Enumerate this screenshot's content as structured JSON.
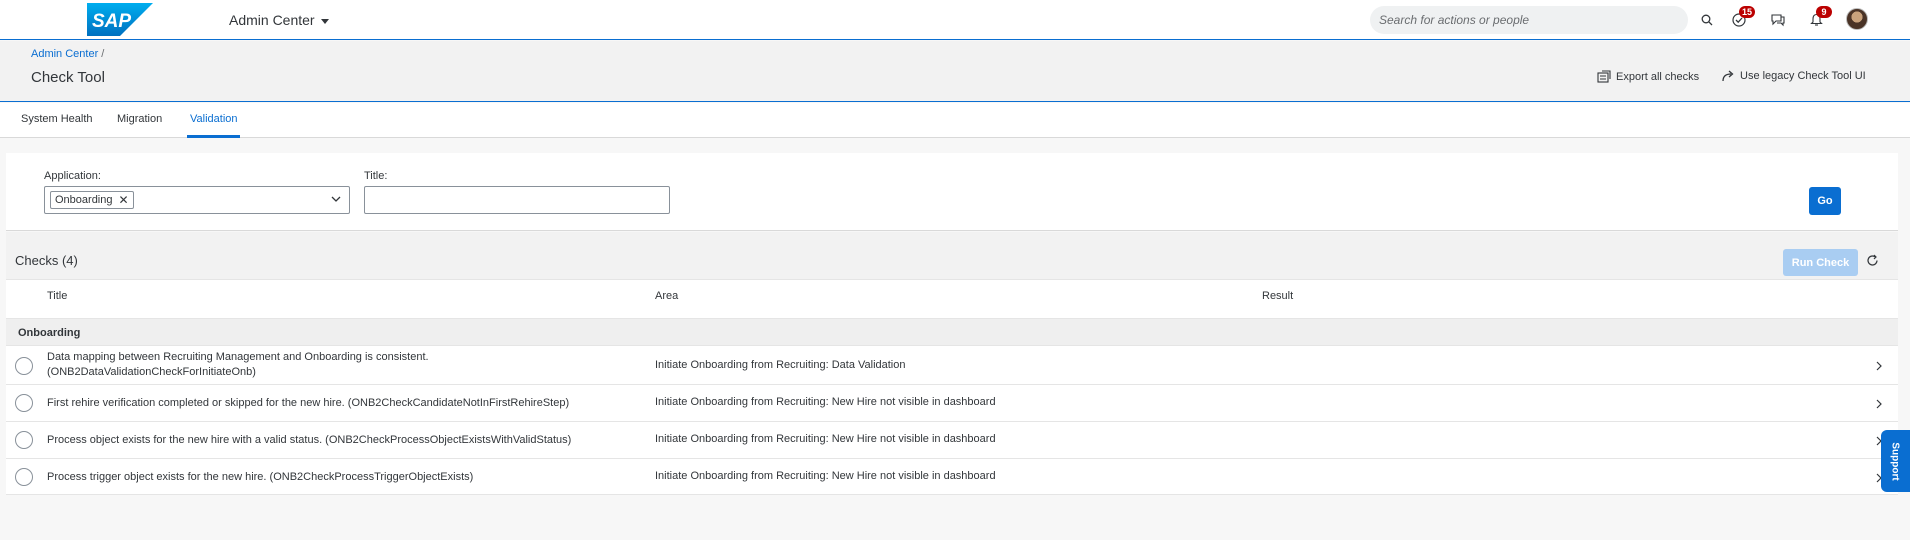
{
  "shell": {
    "logo_text": "SAP",
    "app_title": "Admin Center",
    "search_placeholder": "Search for actions or people",
    "todo_badge": "15",
    "notifications_badge": "9",
    "brand_color": "#0a6ed1"
  },
  "page": {
    "breadcrumb": "Admin Center",
    "breadcrumb_sep": "/",
    "title": "Check Tool",
    "actions": {
      "export": "Export all checks",
      "legacy": "Use legacy Check Tool UI"
    }
  },
  "tabs": [
    {
      "label": "System Health",
      "active": false
    },
    {
      "label": "Migration",
      "active": false
    },
    {
      "label": "Validation",
      "active": true
    }
  ],
  "filter": {
    "application_label": "Application:",
    "application_token": "Onboarding",
    "title_label": "Title:",
    "title_value": "",
    "go_label": "Go"
  },
  "checks": {
    "title": "Checks (4)",
    "run_label": "Run Check",
    "columns": [
      "Title",
      "Area",
      "Result"
    ],
    "group": "Onboarding",
    "rows": [
      {
        "title_line1": "Data mapping between Recruiting Management and Onboarding is consistent.",
        "title_line2": "(ONB2DataValidationCheckForInitiateOnb)",
        "area": "Initiate Onboarding from Recruiting: Data Validation",
        "result": ""
      },
      {
        "title_line1": "First rehire verification completed or skipped for the new hire. (ONB2CheckCandidateNotInFirstRehireStep)",
        "title_line2": "",
        "area": "Initiate Onboarding from Recruiting: New Hire not visible in dashboard",
        "result": ""
      },
      {
        "title_line1": "Process object exists for the new hire with a valid status. (ONB2CheckProcessObjectExistsWithValidStatus)",
        "title_line2": "",
        "area": "Initiate Onboarding from Recruiting: New Hire not visible in dashboard",
        "result": ""
      },
      {
        "title_line1": "Process trigger object exists for the new hire. (ONB2CheckProcessTriggerObjectExists)",
        "title_line2": "",
        "area": "Initiate Onboarding from Recruiting: New Hire not visible in dashboard",
        "result": ""
      }
    ]
  },
  "support_label": "Support"
}
